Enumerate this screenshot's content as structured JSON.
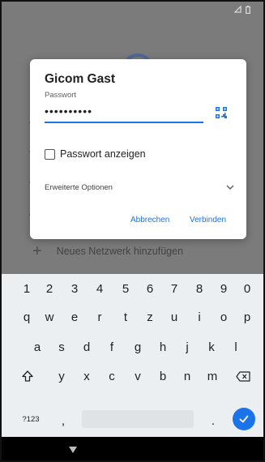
{
  "status_bar": {
    "icons": [
      "signal-icon",
      "battery-icon"
    ]
  },
  "background": {
    "add_network_label": "Neues Netzwerk hinzufügen"
  },
  "dialog": {
    "title": "Gicom Gast",
    "password_label": "Passwort",
    "password_value": "••••••••••",
    "show_password_label": "Passwort anzeigen",
    "show_password_checked": false,
    "advanced_options_label": "Erweiterte Optionen",
    "cancel_label": "Abbrechen",
    "connect_label": "Verbinden",
    "accent_color": "#1a73e8"
  },
  "keyboard": {
    "numbers": [
      "1",
      "2",
      "3",
      "4",
      "5",
      "6",
      "7",
      "8",
      "9",
      "0"
    ],
    "row1": [
      "q",
      "w",
      "e",
      "r",
      "t",
      "z",
      "u",
      "i",
      "o",
      "p"
    ],
    "row2": [
      "a",
      "s",
      "d",
      "f",
      "g",
      "h",
      "j",
      "k",
      "l"
    ],
    "row3": [
      "y",
      "x",
      "c",
      "v",
      "b",
      "n",
      "m"
    ],
    "symbols_key": "?123",
    "comma_key": ",",
    "period_key": "."
  }
}
